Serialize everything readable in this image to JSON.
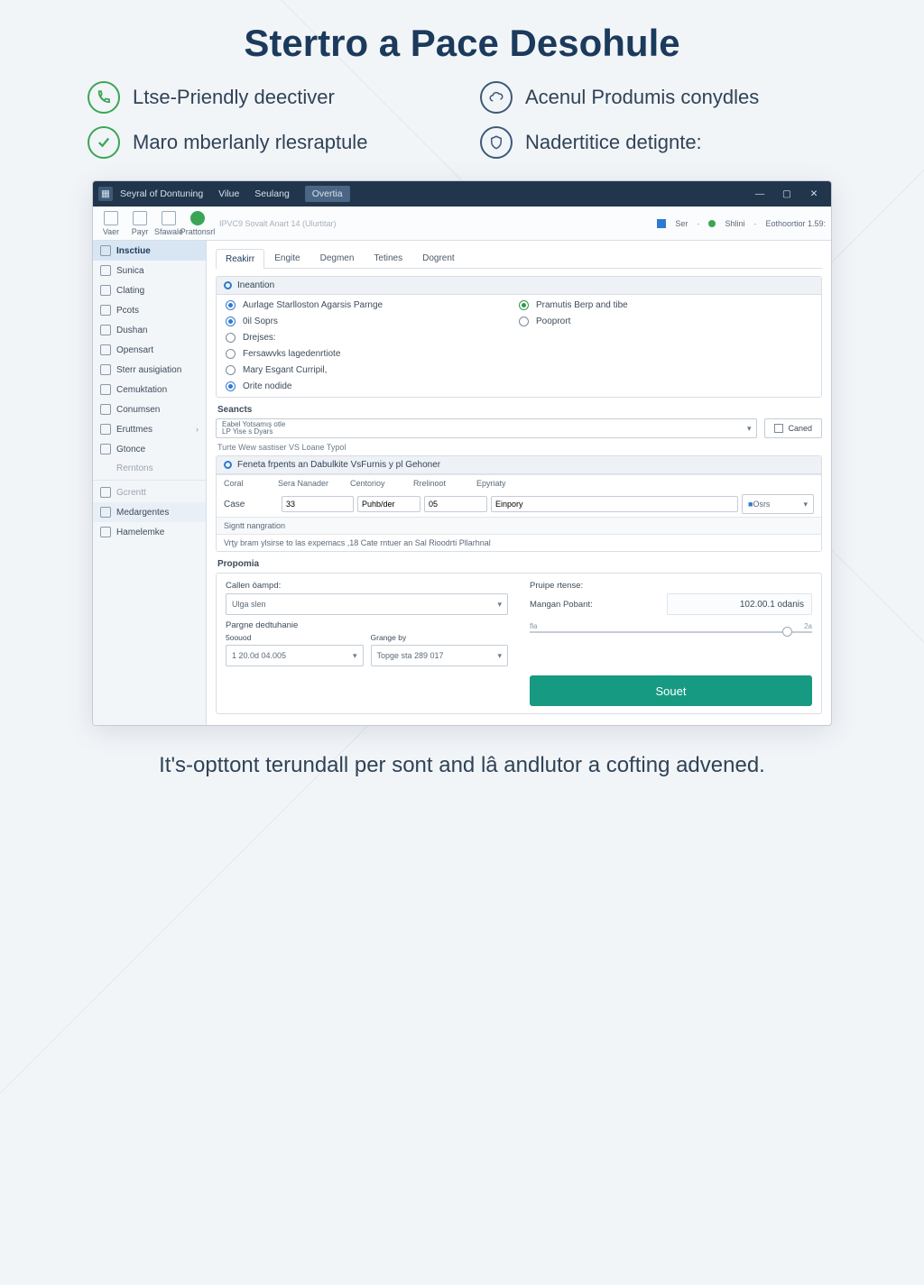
{
  "page_title": "Stertro a Pace Desohule",
  "features": [
    {
      "icon": "phone-icon",
      "style": "green",
      "text": "Ltse-Priendly deectiver"
    },
    {
      "icon": "cloud-icon",
      "style": "blue",
      "text": "Acenul Produmis conydles"
    },
    {
      "icon": "check-icon",
      "style": "green",
      "text": "Maro mberlanly rlesraptule"
    },
    {
      "icon": "shield-icon",
      "style": "blue",
      "text": "Nadertitice detignte:"
    }
  ],
  "window": {
    "title": "Seyral of Dontuning",
    "menus": [
      "Vilue",
      "Seulang",
      "Overtia"
    ],
    "active_menu_index": 2
  },
  "toolbar": {
    "icons": [
      {
        "name": "new-icon",
        "label": "Vaer"
      },
      {
        "name": "open-icon",
        "label": "Payr"
      },
      {
        "name": "wand-icon",
        "label": "Sfawale"
      },
      {
        "name": "run-icon",
        "label": "Prattonsrl"
      }
    ],
    "hint": "IPVC9 Sovalt Anart  14 (Ulurtitar)",
    "status": {
      "flag_label": "Ser",
      "dot_label": "Shlini",
      "meter": "Eothoortior 1.59:"
    }
  },
  "sidebar": {
    "items": [
      {
        "label": "Insctiue",
        "icon": "home-icon",
        "state": "selected"
      },
      {
        "label": "Sunica",
        "icon": "box-icon"
      },
      {
        "label": "Clating",
        "icon": "box-icon"
      },
      {
        "label": "Pcots",
        "icon": "user-icon"
      },
      {
        "label": "Dushan",
        "icon": "db-icon"
      },
      {
        "label": "Opensart",
        "icon": "gear-icon"
      },
      {
        "label": "Sterr ausigiation",
        "icon": "box-icon"
      },
      {
        "label": "Cemuktation",
        "icon": "box-icon"
      },
      {
        "label": "Conumsen",
        "icon": "box-icon"
      },
      {
        "label": "Eruttmes",
        "icon": "calendar-icon",
        "chev": true
      },
      {
        "label": "Gtonce",
        "icon": "box-icon"
      },
      {
        "label": "Rerntons",
        "icon": "none",
        "state": "muted"
      },
      {
        "label": "Gcrentt",
        "icon": "flag-icon",
        "state": "muted2"
      },
      {
        "label": "Medargentes",
        "icon": "cog-icon",
        "state": "selected2"
      },
      {
        "label": "Hamelemke",
        "icon": "clock-icon"
      }
    ]
  },
  "main": {
    "tabs": [
      "Reakirr",
      "Engite",
      "Degmen",
      "Tetines",
      "Dogrent"
    ],
    "active_tab": 0,
    "section_title": "Ineantion",
    "radios_left": [
      {
        "label": "Aurlage Starlloston Agarsis Parnge",
        "sel": "sel"
      },
      {
        "label": "0il Soprs",
        "sel": "sel"
      },
      {
        "label": "Drejses:",
        "sel": ""
      },
      {
        "label": "Fersawvks lagedenrtiote",
        "sel": ""
      },
      {
        "label": "Mary Esgant Curripil,",
        "sel": ""
      },
      {
        "label": "Orite nodide",
        "sel": "sel"
      }
    ],
    "radios_right": [
      {
        "label": "Pramutis Berp and tibe",
        "sel": "green"
      },
      {
        "label": "Pooprort",
        "sel": ""
      }
    ],
    "seancts_label": "Seancts",
    "seancts_value": "Eabel Yotsamış otle\nLP Yise s Dyars",
    "caned_btn": "Caned",
    "caption1": "Turte Wew sastiser VS Loane Typol",
    "caption2": "Feneta frpents an Dabulkite VsFurnis y pl Gehoner",
    "table": {
      "cols": [
        "Coral",
        "Sera Nanader",
        "Centorioy",
        "Rrelinoot",
        "Epyriaty"
      ],
      "row": {
        "a": "Case",
        "b": "33",
        "c": "Puhb/der",
        "d": "05",
        "e": "Einpory",
        "mode": "Osrs"
      }
    },
    "signat_head": "Signtt nangration",
    "signat_body": "Vrţy bram ylsirse to las expemacs ,18 Cate rntuer an Sal Rioodrti Pllarhnal",
    "props_title": "Propomia",
    "callen_label": "Callen öampd:",
    "callen_value": "Ulga slen",
    "pargne_label": "Pargne dedtuhanie",
    "scouod_label": "5oouod",
    "scouod_value": "1 20.0d 04.005",
    "grange_label": "Grange by",
    "grange_value": "Topge sta 289 017",
    "pripe_label": "Pruipe rtense:",
    "pripe_field": "Mangan Pobant:",
    "pripe_value": "102.00.1 odanis",
    "slider": {
      "lo": "fla",
      "hi": "2a"
    },
    "submit": "Souet"
  },
  "footer_copy": "It's-opttont terundall per sont and lâ andlutor a cofting advened."
}
